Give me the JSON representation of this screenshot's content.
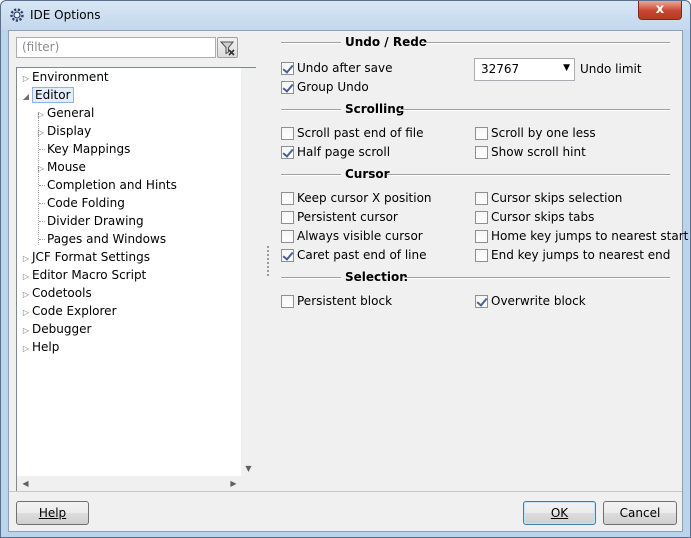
{
  "window": {
    "title": "IDE Options",
    "close_glyph": "x"
  },
  "filter": {
    "placeholder": "(filter)"
  },
  "tree": {
    "items": [
      {
        "label": "Environment",
        "expandable": true,
        "level": 0,
        "expanded": false
      },
      {
        "label": "Editor",
        "expandable": true,
        "level": 0,
        "expanded": true,
        "selected": true
      },
      {
        "label": "General",
        "expandable": true,
        "level": 1
      },
      {
        "label": "Display",
        "expandable": true,
        "level": 1
      },
      {
        "label": "Key Mappings",
        "expandable": false,
        "level": 1
      },
      {
        "label": "Mouse",
        "expandable": true,
        "level": 1
      },
      {
        "label": "Completion and Hints",
        "expandable": false,
        "level": 1
      },
      {
        "label": "Code Folding",
        "expandable": false,
        "level": 1
      },
      {
        "label": "Divider Drawing",
        "expandable": false,
        "level": 1
      },
      {
        "label": "Pages and Windows",
        "expandable": false,
        "level": 1
      },
      {
        "label": "JCF Format Settings",
        "expandable": true,
        "level": 0
      },
      {
        "label": "Editor Macro Script",
        "expandable": true,
        "level": 0
      },
      {
        "label": "Codetools",
        "expandable": true,
        "level": 0
      },
      {
        "label": "Code Explorer",
        "expandable": true,
        "level": 0
      },
      {
        "label": "Debugger",
        "expandable": true,
        "level": 0
      },
      {
        "label": "Help",
        "expandable": true,
        "level": 0
      }
    ]
  },
  "sections": {
    "undo_redo": {
      "title": "Undo / Redo",
      "undo_after_save": {
        "label": "Undo after save",
        "checked": true
      },
      "group_undo": {
        "label": "Group Undo",
        "checked": true
      },
      "undo_limit_value": "32767",
      "undo_limit_label": "Undo limit"
    },
    "scrolling": {
      "title": "Scrolling",
      "scroll_past_eof": {
        "label": "Scroll past end of file",
        "checked": false
      },
      "scroll_by_one_less": {
        "label": "Scroll by one less",
        "checked": false
      },
      "half_page_scroll": {
        "label": "Half page scroll",
        "checked": true
      },
      "show_scroll_hint": {
        "label": "Show scroll hint",
        "checked": false
      }
    },
    "cursor": {
      "title": "Cursor",
      "keep_cursor_x": {
        "label": "Keep cursor X position",
        "checked": false
      },
      "cursor_skips_selection": {
        "label": "Cursor skips selection",
        "checked": false
      },
      "persistent_cursor": {
        "label": "Persistent cursor",
        "checked": false
      },
      "cursor_skips_tabs": {
        "label": "Cursor skips tabs",
        "checked": false
      },
      "always_visible_cursor": {
        "label": "Always visible cursor",
        "checked": false
      },
      "home_key_jumps": {
        "label": "Home key jumps to nearest start",
        "checked": false
      },
      "caret_past_eol": {
        "label": "Caret past end of line",
        "checked": true
      },
      "end_key_jumps": {
        "label": "End key jumps to nearest end",
        "checked": false
      }
    },
    "selection": {
      "title": "Selection",
      "persistent_block": {
        "label": "Persistent block",
        "checked": false
      },
      "overwrite_block": {
        "label": "Overwrite block",
        "checked": true
      }
    }
  },
  "buttons": {
    "help": "Help",
    "ok": "OK",
    "cancel": "Cancel"
  },
  "icons": {
    "app": "gear-icon",
    "filter_clear": "filter-clear-icon",
    "expand": "triangle-right-icon",
    "collapse": "triangle-down-icon"
  }
}
